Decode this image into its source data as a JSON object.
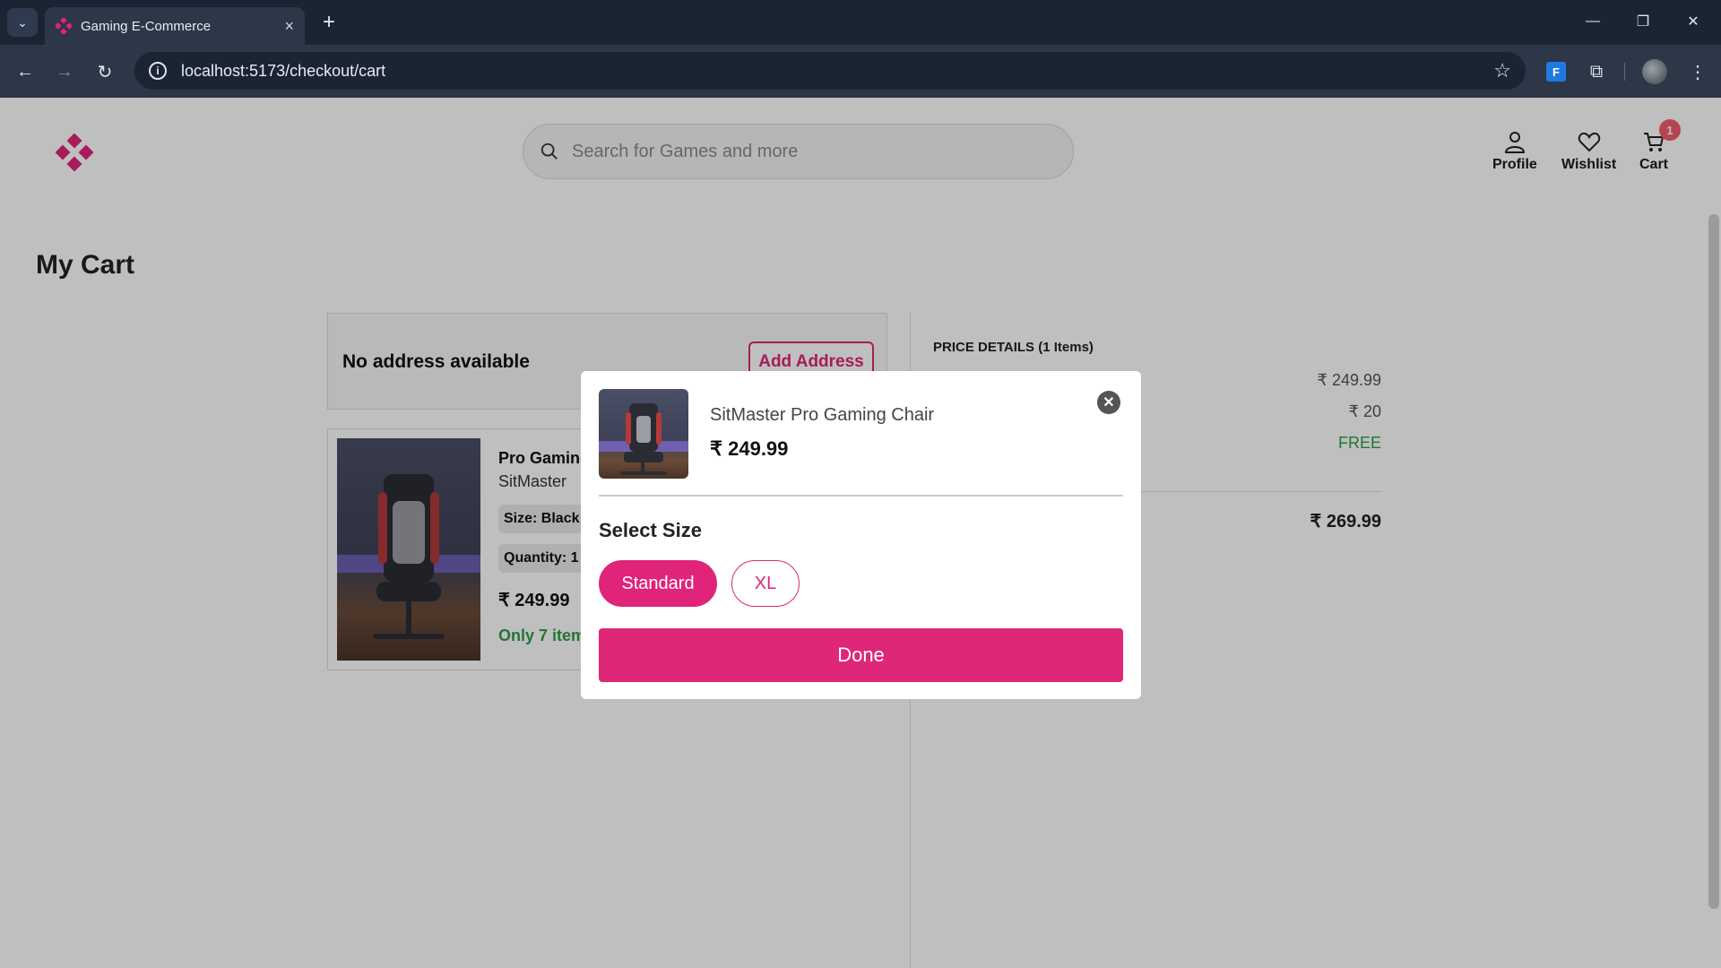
{
  "browser": {
    "tab_title": "Gaming E-Commerce",
    "url": "localhost:5173/checkout/cart"
  },
  "header": {
    "search_placeholder": "Search for Games and more",
    "profile_label": "Profile",
    "wishlist_label": "Wishlist",
    "cart_label": "Cart",
    "cart_count": "1"
  },
  "page": {
    "title": "My Cart",
    "address": {
      "empty_text": "No address available",
      "add_button": "Add Address"
    },
    "cart_item": {
      "name": "Pro Gaming",
      "brand": "SitMaster",
      "size_chip": "Size: Black",
      "quantity_chip": "Quantity: 1",
      "price": "₹ 249.99",
      "stock_note": "Only 7 item"
    },
    "price_details": {
      "title": "PRICE DETAILS (1 Items)",
      "price": "₹ 249.99",
      "fee": "₹ 20",
      "delivery": "FREE",
      "total": "₹ 269.99"
    }
  },
  "modal": {
    "product_name": "SitMaster Pro Gaming Chair",
    "product_price": "₹ 249.99",
    "heading": "Select Size",
    "sizes": [
      {
        "label": "Standard",
        "selected": true
      },
      {
        "label": "XL",
        "selected": false
      }
    ],
    "done_button": "Done"
  },
  "colors": {
    "accent": "#e0247a",
    "success": "#2e9c47"
  }
}
